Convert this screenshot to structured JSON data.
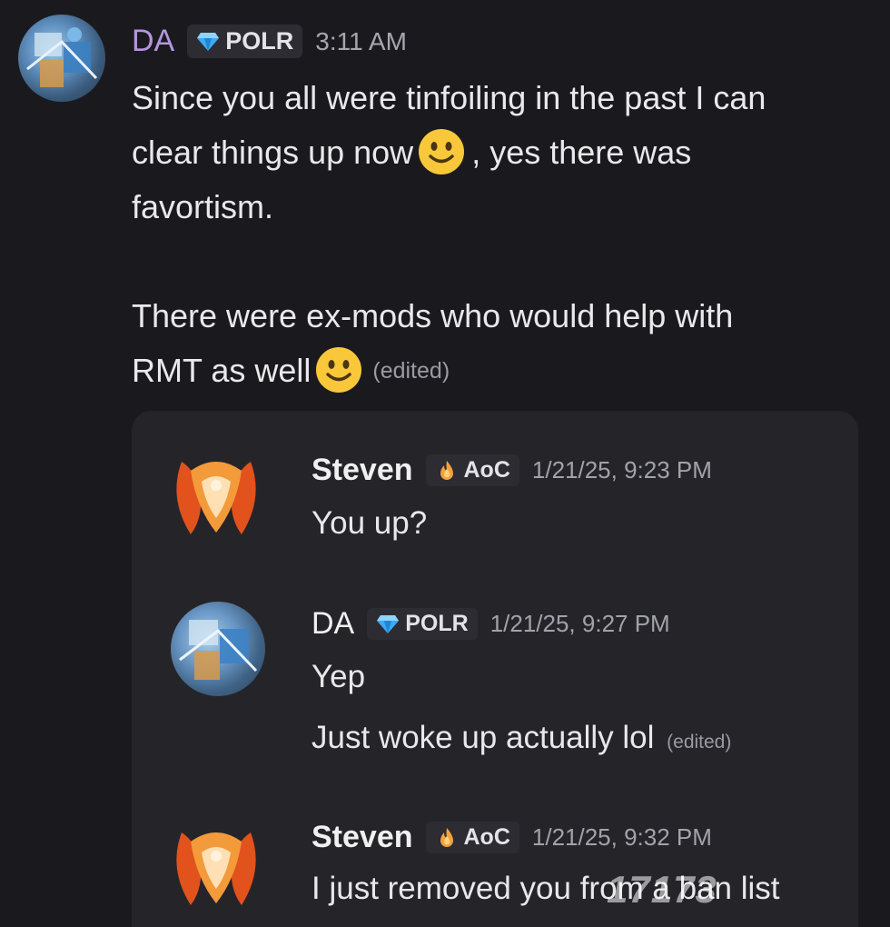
{
  "top_message": {
    "author": "DA",
    "badge": "POLR",
    "time": "3:11 AM",
    "line1": "Since you all were tinfoiling in the past I can",
    "line2a": "clear things up now",
    "line2b": ", yes there was",
    "line3": "favortism.",
    "line4": "There were ex-mods who would help with",
    "line5": "RMT as well",
    "edited": "(edited)"
  },
  "embed": {
    "messages": [
      {
        "author": "Steven",
        "badge": "AoC",
        "time": "1/21/25, 9:23 PM",
        "text": "You up?"
      },
      {
        "author": "DA",
        "badge": "POLR",
        "time": "1/21/25, 9:27 PM",
        "text": "Yep",
        "text2": "Just woke up actually lol",
        "edited": "(edited)"
      },
      {
        "author": "Steven",
        "badge": "AoC",
        "time": "1/21/25, 9:32 PM",
        "text": "I just removed you from a ban list"
      }
    ]
  },
  "watermark": "17173",
  "icons": {
    "gem": "gem-icon",
    "flame": "flame-icon",
    "emoji": "slightly-smiling-face-icon"
  },
  "colors": {
    "background": "#1a1a1e",
    "embed_bg": "#252529",
    "name_da": "#b695e0",
    "gem": "#3fa9f5"
  }
}
